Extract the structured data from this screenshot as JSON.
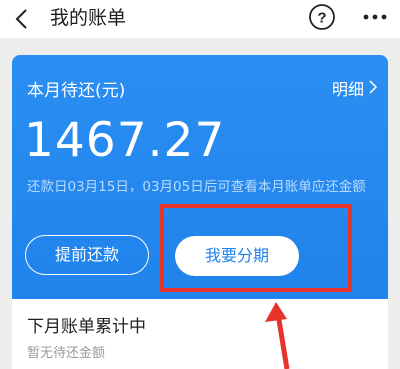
{
  "header": {
    "title": "我的账单",
    "back_icon": "chevron-left-icon",
    "help_icon": "question-circle-icon",
    "more_icon": "more-horizontal-icon"
  },
  "bill_card": {
    "due_label": "本月待还(元)",
    "detail_link": "明细",
    "amount": "1467.27",
    "note": "还款日03月15日，03月05日后可查看本月账单应还金额",
    "prepay_button": "提前还款",
    "installment_button": "我要分期"
  },
  "next_month": {
    "title": "下月账单累计中",
    "subtitle": "暂无待还金额"
  },
  "colors": {
    "card_blue": "#1f83ec",
    "highlight_red": "#e8322c",
    "page_bg": "#ededed"
  }
}
